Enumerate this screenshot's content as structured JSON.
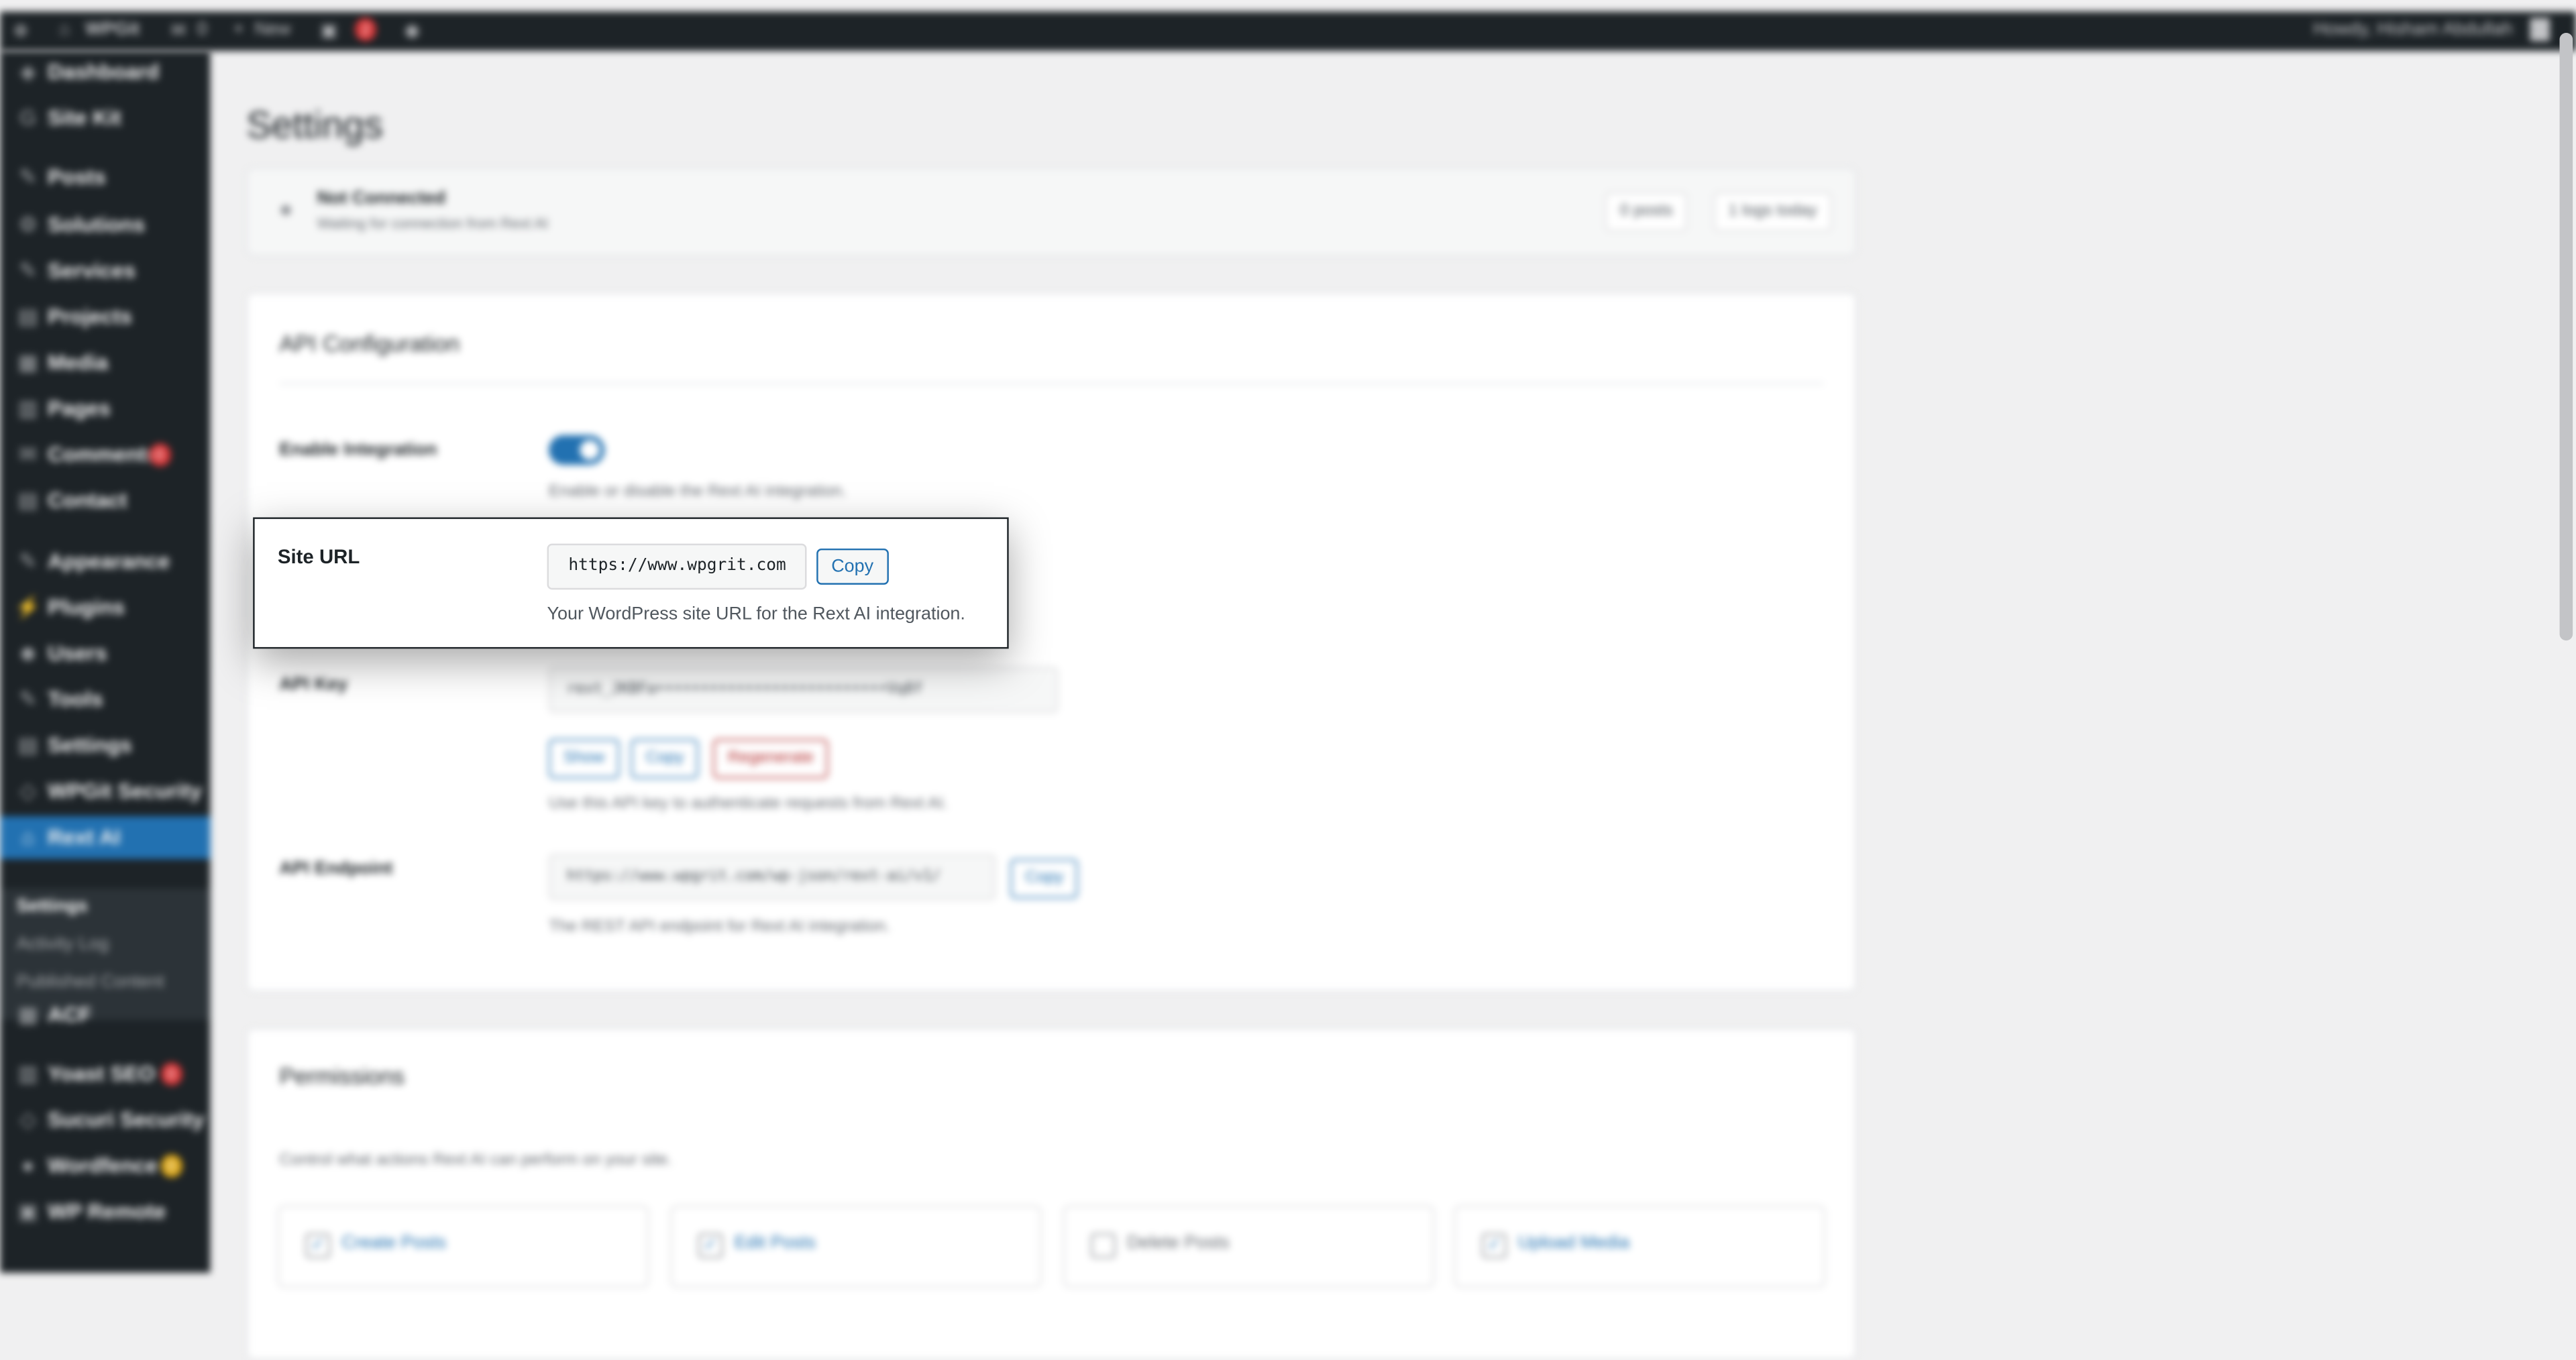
{
  "adminbar": {
    "site_name": "WPGit",
    "comments_count": "0",
    "new_label": "New",
    "updates_badge": "2",
    "greeting": "Howdy, Hisham Abdullah"
  },
  "sidebar": {
    "items": [
      {
        "label": "Dashboard",
        "icon": "dashboard-icon"
      },
      {
        "label": "Site Kit",
        "icon": "sitekit-icon"
      },
      {
        "label": "Posts",
        "icon": "pin-icon"
      },
      {
        "label": "Solutions",
        "icon": "gear-icon"
      },
      {
        "label": "Services",
        "icon": "wrench-icon"
      },
      {
        "label": "Projects",
        "icon": "folder-icon"
      },
      {
        "label": "Media",
        "icon": "media-icon"
      },
      {
        "label": "Pages",
        "icon": "page-icon"
      },
      {
        "label": "Comments",
        "icon": "comment-icon",
        "badge": "0"
      },
      {
        "label": "Contact",
        "icon": "mail-icon"
      },
      {
        "label": "Appearance",
        "icon": "brush-icon"
      },
      {
        "label": "Plugins",
        "icon": "plug-icon"
      },
      {
        "label": "Users",
        "icon": "user-icon"
      },
      {
        "label": "Tools",
        "icon": "tool-icon"
      },
      {
        "label": "Settings",
        "icon": "settings-icon"
      },
      {
        "label": "WPGit Security",
        "icon": "shield-icon"
      },
      {
        "label": "Rext AI",
        "icon": "home-icon",
        "active": true
      },
      {
        "label": "ACF",
        "icon": "grid-icon"
      },
      {
        "label": "Yoast SEO",
        "icon": "seo-icon",
        "badge": "0"
      },
      {
        "label": "Sucuri Security",
        "icon": "security-icon"
      },
      {
        "label": "Wordfence",
        "icon": "wordfence-icon",
        "badge": "0"
      },
      {
        "label": "WP Remote",
        "icon": "remote-icon"
      }
    ],
    "submenu": [
      "Settings",
      "Activity Log",
      "Published Content"
    ]
  },
  "page": {
    "title": "Settings",
    "status": {
      "title": "Not Connected",
      "subtitle": "Waiting for connection from Rext AI",
      "posts": "0 posts",
      "logs": "1 logs today"
    },
    "api": {
      "heading": "API Configuration",
      "enable_label": "Enable Integration",
      "enable_desc": "Enable or disable the Rext AI integration.",
      "enable_on": true,
      "site_url_label": "Site URL",
      "site_url": "https://www.wpgrit.com",
      "site_url_desc": "Your WordPress site URL for the Rext AI integration.",
      "copy_label": "Copy",
      "api_key_label": "API Key",
      "api_key": "rext_JKBFa••••••••••••••••••••••••••Vq8f",
      "show_label": "Show",
      "regenerate_label": "Regenerate",
      "api_key_desc": "Use this API key to authenticate requests from Rext AI.",
      "endpoint_label": "API Endpoint",
      "endpoint": "https://www.wpgrit.com/wp-json/rext-ai/v1/",
      "endpoint_desc": "The REST API endpoint for Rext AI integration."
    },
    "permissions": {
      "heading": "Permissions",
      "desc": "Control what actions Rext AI can perform on your site.",
      "items": [
        {
          "label": "Create Posts",
          "checked": true
        },
        {
          "label": "Edit Posts",
          "checked": true
        },
        {
          "label": "Delete Posts",
          "checked": false
        },
        {
          "label": "Upload Media",
          "checked": true
        }
      ]
    }
  },
  "colors": {
    "accent": "#2271b1",
    "admin_dark": "#1d2327",
    "badge_red": "#d63638",
    "badge_yellow": "#dba617"
  }
}
